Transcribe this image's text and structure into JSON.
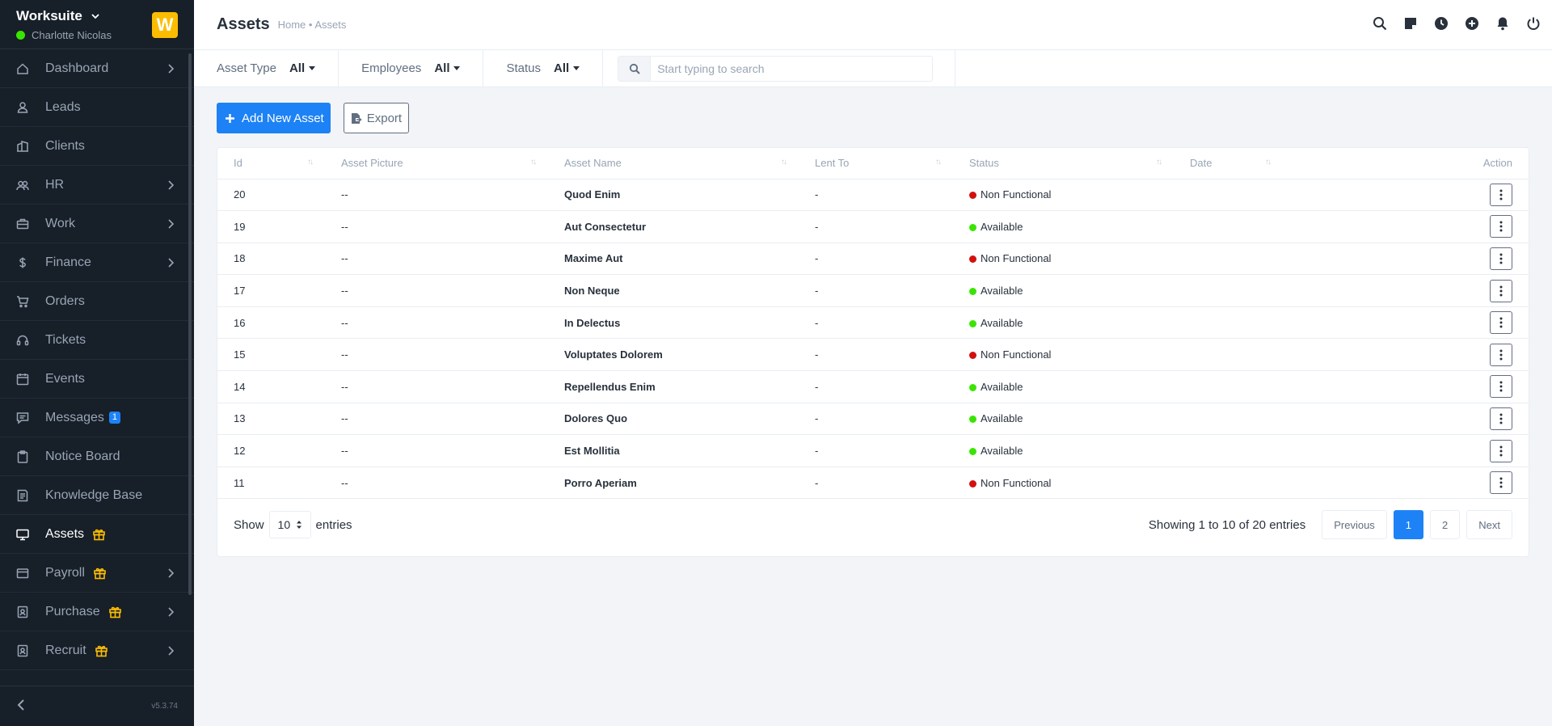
{
  "sidebar": {
    "company": "Worksuite",
    "user": "Charlotte Nicolas",
    "logo_letter": "W",
    "version": "v5.3.74",
    "items": [
      {
        "label": "Dashboard",
        "icon": "house-icon",
        "chevron": true
      },
      {
        "label": "Leads",
        "icon": "person-icon",
        "chevron": false
      },
      {
        "label": "Clients",
        "icon": "building-icon",
        "chevron": false
      },
      {
        "label": "HR",
        "icon": "people-icon",
        "chevron": true
      },
      {
        "label": "Work",
        "icon": "briefcase-icon",
        "chevron": true
      },
      {
        "label": "Finance",
        "icon": "dollar-icon",
        "chevron": true
      },
      {
        "label": "Orders",
        "icon": "cart-icon",
        "chevron": false
      },
      {
        "label": "Tickets",
        "icon": "headset-icon",
        "chevron": false
      },
      {
        "label": "Events",
        "icon": "calendar-icon",
        "chevron": false
      },
      {
        "label": "Messages",
        "icon": "chat-icon",
        "badge": "1",
        "chevron": false
      },
      {
        "label": "Notice Board",
        "icon": "clipboard-icon",
        "chevron": false
      },
      {
        "label": "Knowledge Base",
        "icon": "book-icon",
        "chevron": false
      },
      {
        "label": "Assets",
        "icon": "monitor-icon",
        "gift": true,
        "active": true,
        "chevron": false
      },
      {
        "label": "Payroll",
        "icon": "wallet-icon",
        "gift": true,
        "chevron": true
      },
      {
        "label": "Purchase",
        "icon": "badge-icon",
        "gift": true,
        "chevron": true
      },
      {
        "label": "Recruit",
        "icon": "id-card-icon",
        "gift": true,
        "chevron": true
      }
    ]
  },
  "header": {
    "title": "Assets",
    "breadcrumb": "Home • Assets"
  },
  "filters": {
    "asset_type_label": "Asset Type",
    "asset_type_value": "All",
    "employees_label": "Employees",
    "employees_value": "All",
    "status_label": "Status",
    "status_value": "All",
    "search_placeholder": "Start typing to search"
  },
  "actions": {
    "add_label": "Add New Asset",
    "export_label": "Export"
  },
  "table": {
    "columns": [
      "Id",
      "Asset Picture",
      "Asset Name",
      "Lent To",
      "Status",
      "Date",
      "Action"
    ],
    "rows": [
      {
        "id": "20",
        "picture": "--",
        "name": "Quod Enim",
        "lent_to": "-",
        "status": "Non Functional",
        "status_color": "#d21010"
      },
      {
        "id": "19",
        "picture": "--",
        "name": "Aut Consectetur",
        "lent_to": "-",
        "status": "Available",
        "status_color": "#39e500"
      },
      {
        "id": "18",
        "picture": "--",
        "name": "Maxime Aut",
        "lent_to": "-",
        "status": "Non Functional",
        "status_color": "#d21010"
      },
      {
        "id": "17",
        "picture": "--",
        "name": "Non Neque",
        "lent_to": "-",
        "status": "Available",
        "status_color": "#39e500"
      },
      {
        "id": "16",
        "picture": "--",
        "name": "In Delectus",
        "lent_to": "-",
        "status": "Available",
        "status_color": "#39e500"
      },
      {
        "id": "15",
        "picture": "--",
        "name": "Voluptates Dolorem",
        "lent_to": "-",
        "status": "Non Functional",
        "status_color": "#d21010"
      },
      {
        "id": "14",
        "picture": "--",
        "name": "Repellendus Enim",
        "lent_to": "-",
        "status": "Available",
        "status_color": "#39e500"
      },
      {
        "id": "13",
        "picture": "--",
        "name": "Dolores Quo",
        "lent_to": "-",
        "status": "Available",
        "status_color": "#39e500"
      },
      {
        "id": "12",
        "picture": "--",
        "name": "Est Mollitia",
        "lent_to": "-",
        "status": "Available",
        "status_color": "#39e500"
      },
      {
        "id": "11",
        "picture": "--",
        "name": "Porro Aperiam",
        "lent_to": "-",
        "status": "Non Functional",
        "status_color": "#d21010"
      }
    ]
  },
  "footer": {
    "show_label": "Show",
    "show_value": "10",
    "entries_label": "entries",
    "info": "Showing 1 to 10 of 20 entries",
    "previous": "Previous",
    "pages": [
      "1",
      "2"
    ],
    "next": "Next"
  },
  "colors": {
    "primary": "#1d82f5",
    "sidebar_bg": "#171f29",
    "logo": "#fcbd01",
    "non_functional": "#d21010",
    "available": "#39e500"
  }
}
